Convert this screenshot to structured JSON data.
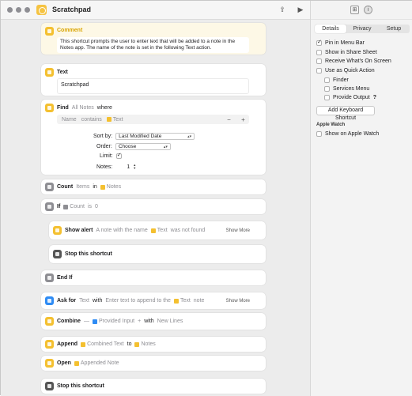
{
  "window": {
    "title": "Scratchpad"
  },
  "sidebar": {
    "tabs": [
      "Details",
      "Privacy",
      "Setup"
    ],
    "options": [
      {
        "label": "Pin in Menu Bar",
        "checked": true
      },
      {
        "label": "Show in Share Sheet",
        "checked": false
      },
      {
        "label": "Receive What's On Screen",
        "checked": false
      },
      {
        "label": "Use as Quick Action",
        "checked": false
      },
      {
        "label": "Finder",
        "checked": false
      },
      {
        "label": "Services Menu",
        "checked": false
      },
      {
        "label": "Provide Output",
        "checked": false
      }
    ],
    "help_glyph": "?",
    "add_shortcut_button": "Add Keyboard Shortcut",
    "apple_watch_heading": "Apple Watch",
    "apple_watch_option": {
      "label": "Show on Apple Watch",
      "checked": false
    }
  },
  "actions": {
    "comment": {
      "title": "Comment",
      "text": "This shortcut prompts the user to enter text that will be added to a note in the Notes app. The name of the note is set in the following Text action."
    },
    "text": {
      "title": "Text",
      "value": "Scratchpad"
    },
    "find": {
      "verb": "Find",
      "subject": "All Notes",
      "where": "where",
      "filter_field": "Name",
      "filter_op": "contains",
      "filter_value": "Text",
      "sort_by_label": "Sort by:",
      "sort_by_value": "Last Modified Date",
      "order_label": "Order:",
      "order_value": "Choose",
      "limit_label": "Limit:",
      "limit_checked": true,
      "notes_label": "Notes:",
      "notes_value": "1"
    },
    "count": {
      "verb": "Count",
      "what": "Items",
      "in": "in",
      "source": "Notes"
    },
    "if": {
      "verb": "If",
      "var": "Count",
      "op": "is",
      "value": "0"
    },
    "show_alert": {
      "verb": "Show alert",
      "prefix": "A note with the name",
      "var": "Text",
      "suffix": "was not found",
      "more": "Show More"
    },
    "stop1": {
      "verb": "Stop this shortcut"
    },
    "end_if": {
      "verb": "End If"
    },
    "ask_for": {
      "verb": "Ask for",
      "type": "Text",
      "with": "with",
      "prompt": "Enter text to append to the",
      "var": "Text",
      "suffix": "note",
      "more": "Show More"
    },
    "combine": {
      "verb": "Combine",
      "dash": "—",
      "input": "Provided Input",
      "plus": "+",
      "with": "with",
      "sep": "New Lines"
    },
    "append": {
      "verb": "Append",
      "what": "Combined Text",
      "to": "to",
      "target": "Notes"
    },
    "open": {
      "verb": "Open",
      "what": "Appended Note"
    },
    "stop2": {
      "verb": "Stop this shortcut"
    }
  },
  "toolbar": {
    "share_icon": "share-icon",
    "run_icon": "play-icon",
    "minus": "−",
    "plus": "+",
    "run_glyph": "▶",
    "share_glyph": "⇪"
  }
}
